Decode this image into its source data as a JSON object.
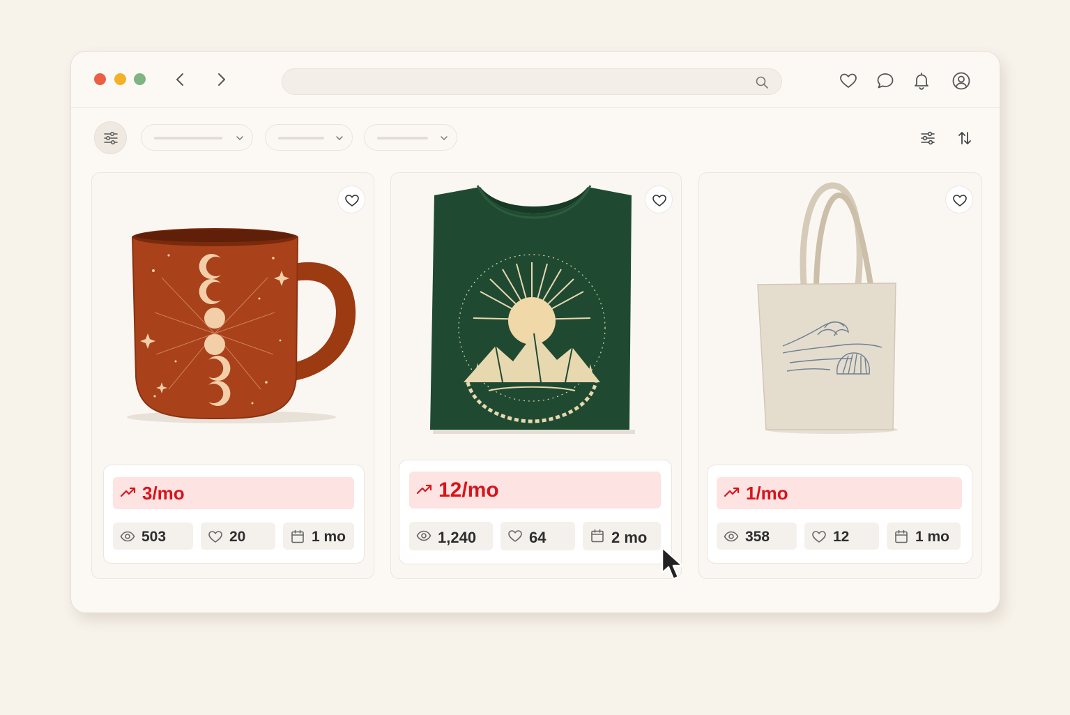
{
  "browser": {
    "url": "",
    "search_icon": "search-icon",
    "top_icons": [
      "heart-icon",
      "chat-icon",
      "bell-icon",
      "user-icon"
    ]
  },
  "toolbar": {
    "dropdowns": [
      "",
      "",
      ""
    ],
    "tools": [
      "filter-icon",
      "sort-icon"
    ]
  },
  "products": [
    {
      "name": "moon-phase-mug",
      "trend": "3/mo",
      "views": "503",
      "likes": "20",
      "age": "1 mo"
    },
    {
      "name": "sun-mountain-tshirt",
      "trend": "12/mo",
      "views": "1,240",
      "likes": "64",
      "age": "2 mo"
    },
    {
      "name": "wave-shell-tote-bag",
      "trend": "1/mo",
      "views": "358",
      "likes": "12",
      "age": "1 mo"
    }
  ],
  "colors": {
    "accent": "#d8141b",
    "trend_bg": "#fde3e2",
    "background": "#f7f2ea",
    "window": "#fcf9f5",
    "traffic_red": "#ec5f45",
    "traffic_yellow": "#f3b129",
    "traffic_green": "#7fb483"
  }
}
